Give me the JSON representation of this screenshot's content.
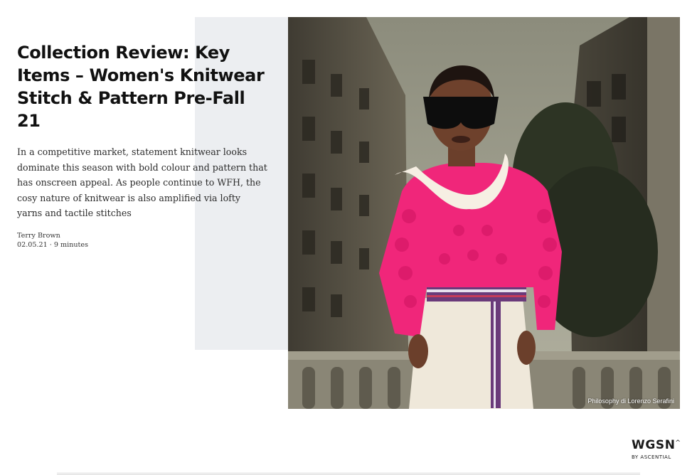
{
  "article": {
    "title": "Collection Review: Key Items – Women's Knitwear Stitch & Pattern Pre-Fall 21",
    "summary": "In a competitive market, statement knitwear looks dominate this season with bold colour and pattern that has onscreen appeal. As people continue to WFH, the cosy nature of knitwear is also amplified via lofty yarns and tactile stitches",
    "author": "Terry Brown",
    "date_readtime": "02.05.21 · 9 minutes"
  },
  "image": {
    "caption": "Philosophy di Lorenzo Serafini",
    "description_icon": "fashion-photo"
  },
  "brand": {
    "logo_text": "WGSN",
    "logo_caret": "^",
    "logo_sub": "BY ASCENTIAL"
  },
  "colors": {
    "panel_grey": "#eceef1",
    "sweater_pink": "#f0267a",
    "text_dark": "#111111"
  }
}
